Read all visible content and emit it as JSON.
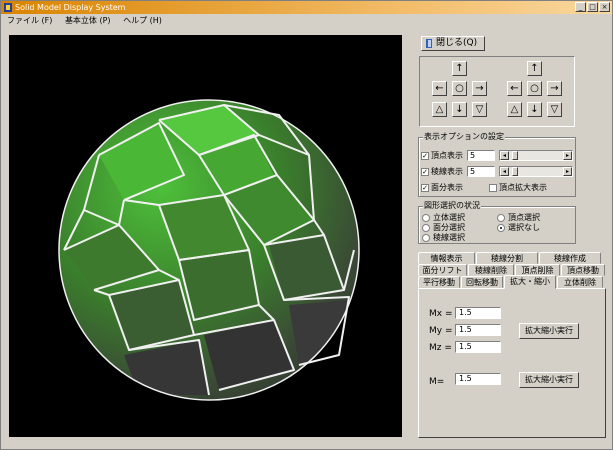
{
  "window": {
    "title": "Solid Model Display System",
    "controls": [
      "_",
      "□",
      "×"
    ]
  },
  "menu": [
    "ファイル (F)",
    "基本立体 (P)",
    "ヘルプ (H)"
  ],
  "close_button": "閉じる(Q)",
  "navigation": {
    "left_group": {
      "up": "↑",
      "left": "←",
      "center": "○",
      "right": "→",
      "tri_up": "△",
      "down": "↓",
      "tri_down": "▽"
    },
    "right_group": {
      "up": "↑",
      "left": "←",
      "center": "○",
      "right": "→",
      "tri_up": "△",
      "down": "↓",
      "tri_down": "▽"
    }
  },
  "display_options": {
    "title": "表示オプションの設定",
    "vertex_display": {
      "label": "頂点表示",
      "checked": true,
      "value": "5"
    },
    "edge_display": {
      "label": "稜線表示",
      "checked": true,
      "value": "5"
    },
    "face_display": {
      "label": "面分表示",
      "checked": true
    },
    "vertex_enlarge": {
      "label": "頂点拡大表示",
      "checked": false
    }
  },
  "selection": {
    "title": "図形選択の状況",
    "options": [
      {
        "label": "立体選択",
        "selected": false
      },
      {
        "label": "頂点選択",
        "selected": false
      },
      {
        "label": "面分選択",
        "selected": false
      },
      {
        "label": "選択なし",
        "selected": true
      },
      {
        "label": "稜線選択",
        "selected": false
      }
    ]
  },
  "tabs": {
    "row1": [
      "情報表示",
      "稜線分割",
      "稜線作成"
    ],
    "row2": [
      "面分リフト",
      "稜線削除",
      "頂点削除",
      "頂点移動"
    ],
    "row3": [
      "平行移動",
      "回転移動",
      "拡大・縮小",
      "立体削除"
    ],
    "active": "拡大・縮小"
  },
  "scale": {
    "mx_label": "Mx =",
    "mx_value": "1.5",
    "my_label": "My =",
    "my_value": "1.5",
    "mz_label": "Mz =",
    "mz_value": "1.5",
    "m_label": "M=",
    "m_value": "1.5",
    "apply_xyz": "拡大縮小実行",
    "apply_uniform": "拡大縮小実行"
  }
}
